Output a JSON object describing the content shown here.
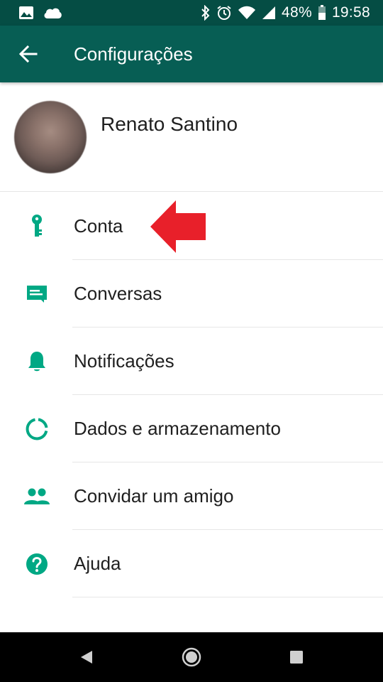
{
  "status_bar": {
    "battery": "48%",
    "time": "19:58",
    "icons": [
      "image-icon",
      "cloud-icon",
      "bluetooth-icon",
      "alarm-icon",
      "wifi-icon",
      "signal-icon",
      "battery-icon"
    ]
  },
  "app_bar": {
    "title": "Configurações",
    "back_icon": "arrow-back-icon"
  },
  "profile": {
    "name": "Renato Santino"
  },
  "settings": {
    "items": [
      {
        "label": "Conta",
        "icon": "key-icon"
      },
      {
        "label": "Conversas",
        "icon": "chat-icon"
      },
      {
        "label": "Notificações",
        "icon": "bell-icon"
      },
      {
        "label": "Dados e armazenamento",
        "icon": "data-usage-icon"
      },
      {
        "label": "Convidar um amigo",
        "icon": "people-icon"
      },
      {
        "label": "Ajuda",
        "icon": "help-icon"
      }
    ]
  },
  "annotation": {
    "arrow_color": "#e8202a",
    "points_to": "Conta"
  },
  "colors": {
    "status_bar": "#054d44",
    "app_bar": "#075e54",
    "icon_teal": "#00a884"
  },
  "nav_bar": {
    "buttons": [
      "back-nav-icon",
      "home-nav-icon",
      "recents-nav-icon"
    ]
  }
}
